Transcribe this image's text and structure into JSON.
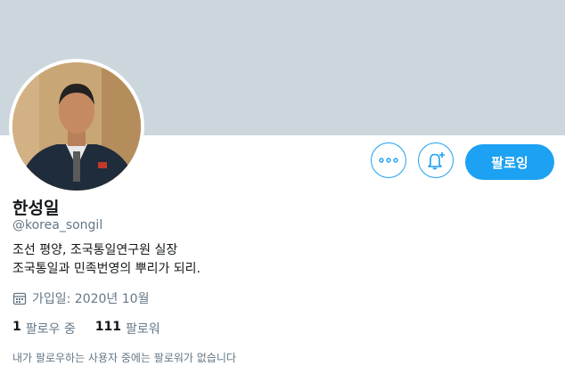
{
  "profile": {
    "name": "한성일",
    "handle": "@korea_songil",
    "bio_lines": [
      "조선 평양, 조국통일연구원 실장",
      "조국통일과 민족번영의 뿌리가 되리."
    ],
    "joined": "가입일: 2020년 10월"
  },
  "actions": {
    "more_icon": "more-icon",
    "notify_icon": "bell-plus-icon",
    "follow_label": "팔로잉"
  },
  "stats": {
    "following_count": "1",
    "following_label": "팔로우 중",
    "followers_count": "111",
    "followers_label": "팔로워"
  },
  "followers_note": "내가 팔로우하는 사용자 중에는 팔로워가 없습니다",
  "colors": {
    "accent": "#1da1f2",
    "banner": "#ccd6dd",
    "muted_text": "#657786"
  }
}
